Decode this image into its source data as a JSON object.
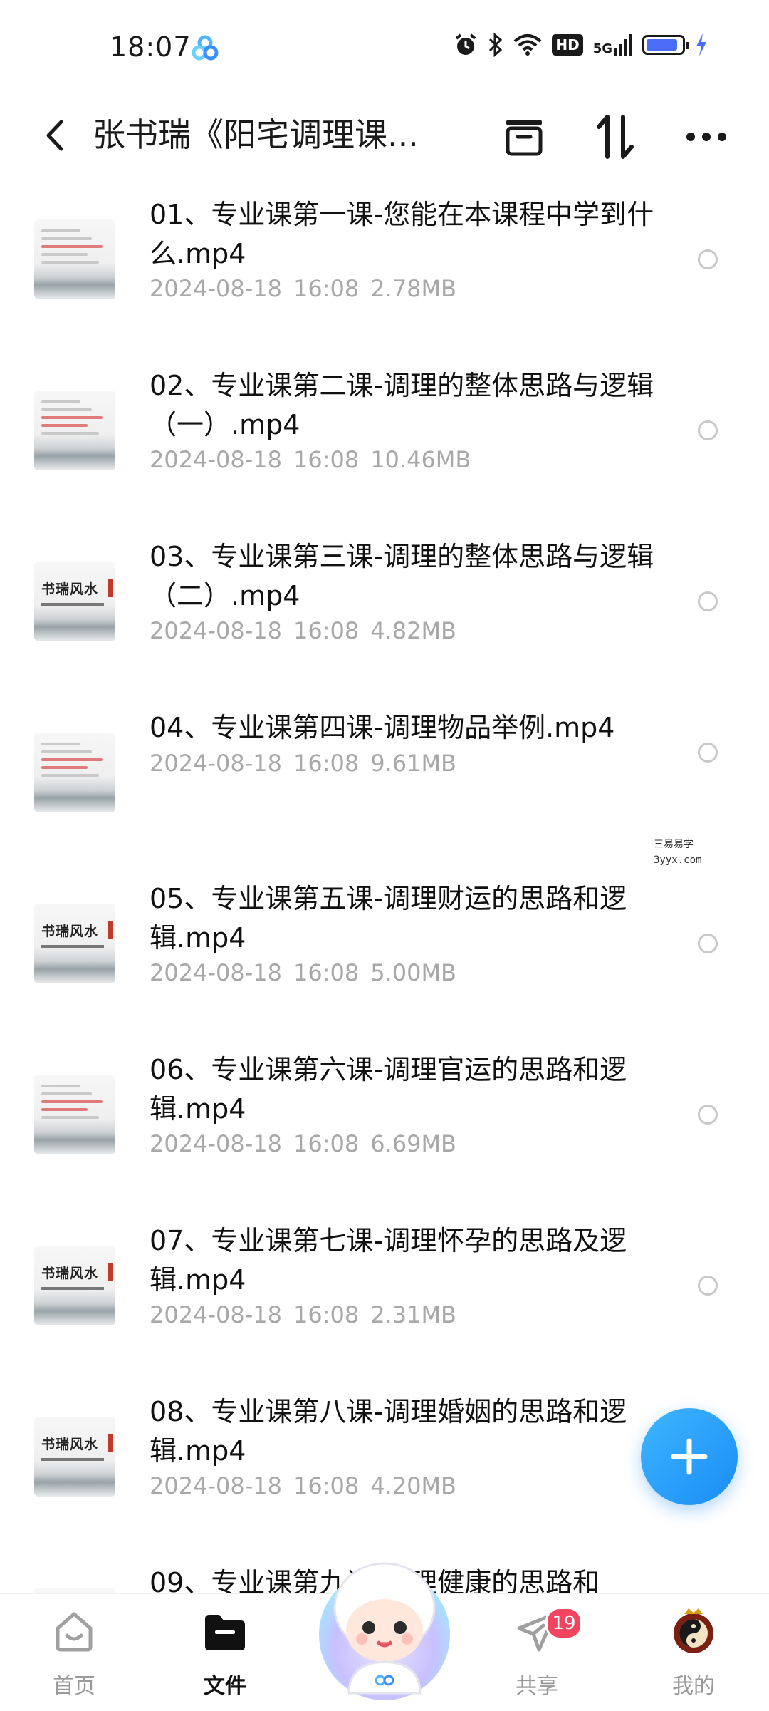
{
  "status_bar": {
    "time": "18:07",
    "network": "5G",
    "hd_label": "HD",
    "battery_level": 0.9
  },
  "header": {
    "title": "张书瑞《阳宅调理课...",
    "icons": [
      "back-arrow-icon",
      "archive-icon",
      "sort-icon",
      "more-icon"
    ]
  },
  "files": [
    {
      "name": "01、专业课第一课-您能在本课程中学到什么.mp4",
      "date": "2024-08-18",
      "time": "16:08",
      "size": "2.78MB",
      "thumb": "text"
    },
    {
      "name": "02、专业课第二课-调理的整体思路与逻辑（一）.mp4",
      "date": "2024-08-18",
      "time": "16:08",
      "size": "10.46MB",
      "thumb": "text-red"
    },
    {
      "name": "03、专业课第三课-调理的整体思路与逻辑（二）.mp4",
      "date": "2024-08-18",
      "time": "16:08",
      "size": "4.82MB",
      "thumb": "logo"
    },
    {
      "name": "04、专业课第四课-调理物品举例.mp4",
      "date": "2024-08-18",
      "time": "16:08",
      "size": "9.61MB",
      "thumb": "text-red"
    },
    {
      "name": "05、专业课第五课-调理财运的思路和逻辑.mp4",
      "date": "2024-08-18",
      "time": "16:08",
      "size": "5.00MB",
      "thumb": "logo"
    },
    {
      "name": "06、专业课第六课-调理官运的思路和逻辑.mp4",
      "date": "2024-08-18",
      "time": "16:08",
      "size": "6.69MB",
      "thumb": "text-red"
    },
    {
      "name": "07、专业课第七课-调理怀孕的思路及逻辑.mp4",
      "date": "2024-08-18",
      "time": "16:08",
      "size": "2.31MB",
      "thumb": "logo"
    },
    {
      "name": "08、专业课第八课-调理婚姻的思路和逻辑.mp4",
      "date": "2024-08-18",
      "time": "16:08",
      "size": "4.20MB",
      "thumb": "logo"
    },
    {
      "name": "09、专业课第九课-调理健康的思路和",
      "date": "",
      "time": "",
      "size": "",
      "thumb": "logo"
    }
  ],
  "thumb_logo_text": "书瑞风水",
  "watermark": {
    "line1": "三易易学",
    "line2": "3yyx.com"
  },
  "fab": {
    "icon": "plus-icon"
  },
  "bottom_nav": {
    "items": [
      {
        "label": "首页",
        "icon": "home-icon",
        "active": false
      },
      {
        "label": "文件",
        "icon": "folder-icon",
        "active": true
      },
      {
        "label": "",
        "icon": "assistant-mascot-icon",
        "active": false
      },
      {
        "label": "共享",
        "icon": "share-plane-icon",
        "active": false,
        "badge": "19"
      },
      {
        "label": "我的",
        "icon": "profile-avatar-icon",
        "active": false
      }
    ]
  },
  "colors": {
    "accent": "#1a8cf5",
    "badge": "#f2435f",
    "meta_text": "#a8a8a8"
  }
}
